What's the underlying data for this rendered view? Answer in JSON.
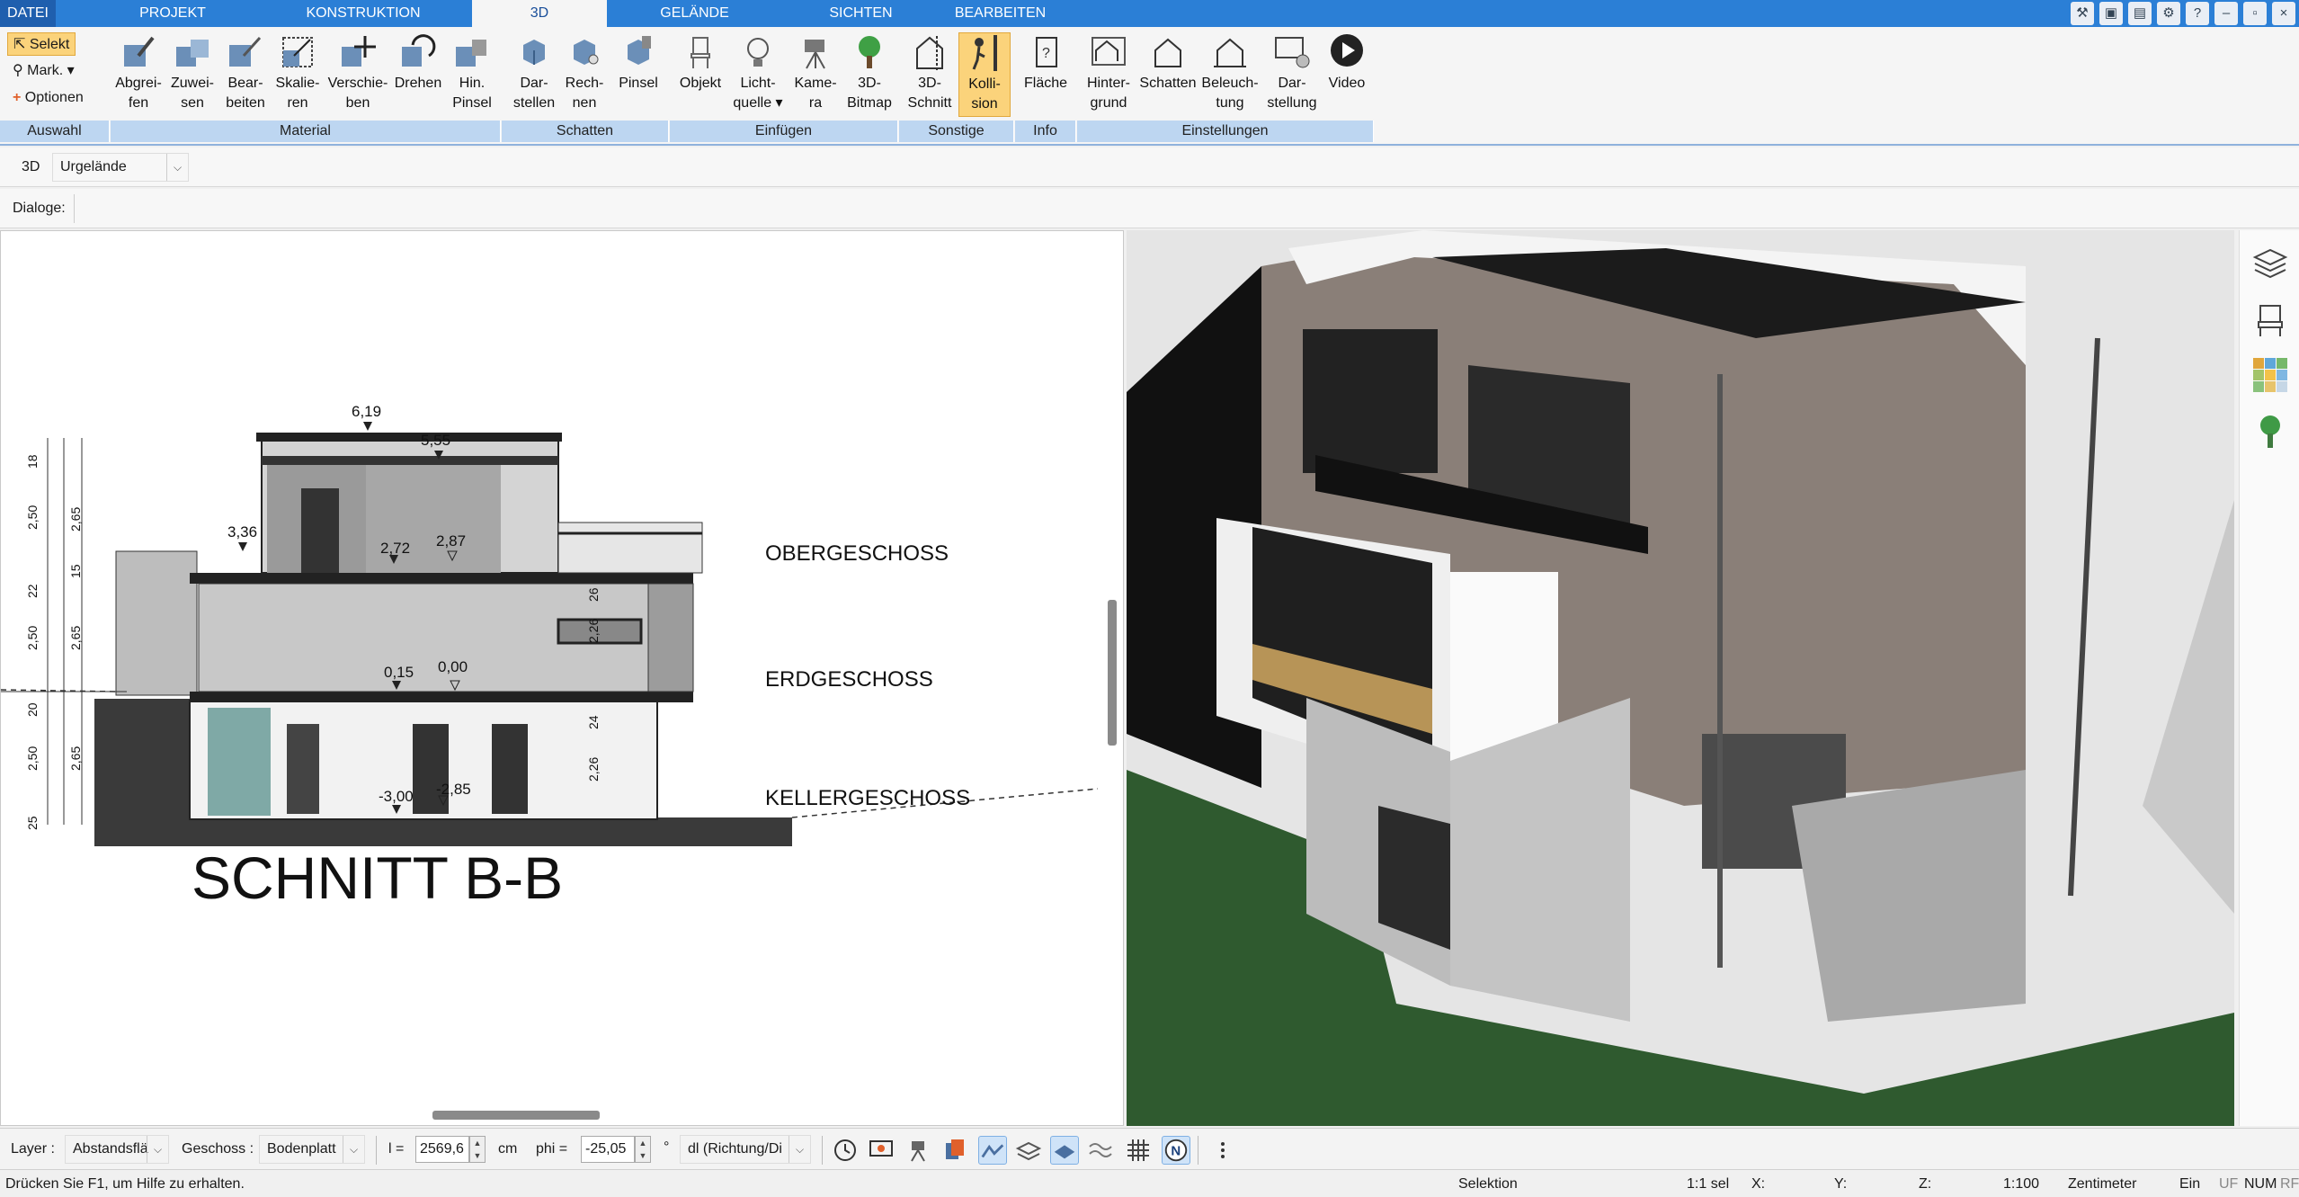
{
  "tabs": [
    {
      "label": "DATEI"
    },
    {
      "label": "PROJEKT"
    },
    {
      "label": "KONSTRUKTION"
    },
    {
      "label": "3D"
    },
    {
      "label": "GELÄNDE"
    },
    {
      "label": "SICHTEN"
    },
    {
      "label": "BEARBEITEN"
    }
  ],
  "active_tab": "3D",
  "ribbon": {
    "auswahl": {
      "select": "Selekt",
      "mark": "Mark.",
      "options": "Optionen",
      "group": "Auswahl"
    },
    "material": {
      "group": "Material",
      "buttons": [
        {
          "l1": "Abgrei-",
          "l2": "fen"
        },
        {
          "l1": "Zuwei-",
          "l2": "sen"
        },
        {
          "l1": "Bear-",
          "l2": "beiten"
        },
        {
          "l1": "Skalie-",
          "l2": "ren"
        },
        {
          "l1": "Verschie-",
          "l2": "ben"
        },
        {
          "l1": "Drehen",
          "l2": ""
        },
        {
          "l1": "Hin.",
          "l2": "Pinsel"
        }
      ]
    },
    "schatten": {
      "group": "Schatten",
      "buttons": [
        {
          "l1": "Dar-",
          "l2": "stellen"
        },
        {
          "l1": "Rech-",
          "l2": "nen"
        },
        {
          "l1": "Pinsel",
          "l2": ""
        }
      ]
    },
    "einfuegen": {
      "group": "Einfügen",
      "buttons": [
        {
          "l1": "Objekt",
          "l2": ""
        },
        {
          "l1": "Licht-",
          "l2": "quelle"
        },
        {
          "l1": "Kame-",
          "l2": "ra"
        },
        {
          "l1": "3D-",
          "l2": "Bitmap"
        }
      ]
    },
    "sonstige": {
      "group": "Sonstige",
      "buttons": [
        {
          "l1": "3D-",
          "l2": "Schnitt"
        },
        {
          "l1": "Kolli-",
          "l2": "sion"
        }
      ]
    },
    "info": {
      "group": "Info",
      "buttons": [
        {
          "l1": "Fläche",
          "l2": ""
        }
      ]
    },
    "einstellungen": {
      "group": "Einstellungen",
      "buttons": [
        {
          "l1": "Hinter-",
          "l2": "grund"
        },
        {
          "l1": "Schatten",
          "l2": ""
        },
        {
          "l1": "Beleuch-",
          "l2": "tung"
        },
        {
          "l1": "Dar-",
          "l2": "stellung"
        },
        {
          "l1": "Video",
          "l2": ""
        }
      ]
    }
  },
  "view_bar": {
    "mode": "3D",
    "combo": "Urgelände"
  },
  "dialog_bar": {
    "label": "Dialoge:"
  },
  "section": {
    "title": "SCHNITT B-B",
    "floors": [
      "OBERGESCHOSS",
      "ERDGESCHOSS",
      "KELLERGESCHOSS"
    ],
    "dims": {
      "top_619": "6,19",
      "top_555": "5,55",
      "d336": "3,36",
      "d287": "2,87",
      "d272": "2,72",
      "d015": "0,15",
      "d000": "0,00",
      "d300": "-3,00",
      "d285": "-2,85",
      "v18": "18",
      "v250a": "2,50",
      "v265a": "2,65",
      "v22": "22",
      "v15": "15",
      "v250b": "2,50",
      "v265b": "2,65",
      "v20": "20",
      "v250c": "2,50",
      "v265c": "2,65",
      "v25": "25",
      "in226a": "2,26",
      "in226b": "2,26",
      "in24": "24",
      "in26": "26"
    }
  },
  "bottom": {
    "layer_label": "Layer :",
    "layer_value": "Abstandsflä",
    "geschoss_label": "Geschoss :",
    "geschoss_value": "Bodenplatt",
    "l_label": "l =",
    "l_value": "2569,6",
    "l_unit": "cm",
    "phi_label": "phi =",
    "phi_value": "-25,05",
    "phi_unit": "°",
    "dl_value": "dl (Richtung/Di"
  },
  "status": {
    "help": "Drücken Sie F1, um Hilfe zu erhalten.",
    "mode": "Selektion",
    "sel": "1:1 sel",
    "x": "X:",
    "y": "Y:",
    "z": "Z:",
    "scale": "1:100",
    "unit": "Zentimeter",
    "ein": "Ein",
    "flags": [
      "UF",
      "NUM",
      "RF"
    ]
  },
  "colors": {
    "tab_blue": "#2b7fd6",
    "group_blue": "#bdd6f1",
    "highlight": "#fbd37b"
  }
}
